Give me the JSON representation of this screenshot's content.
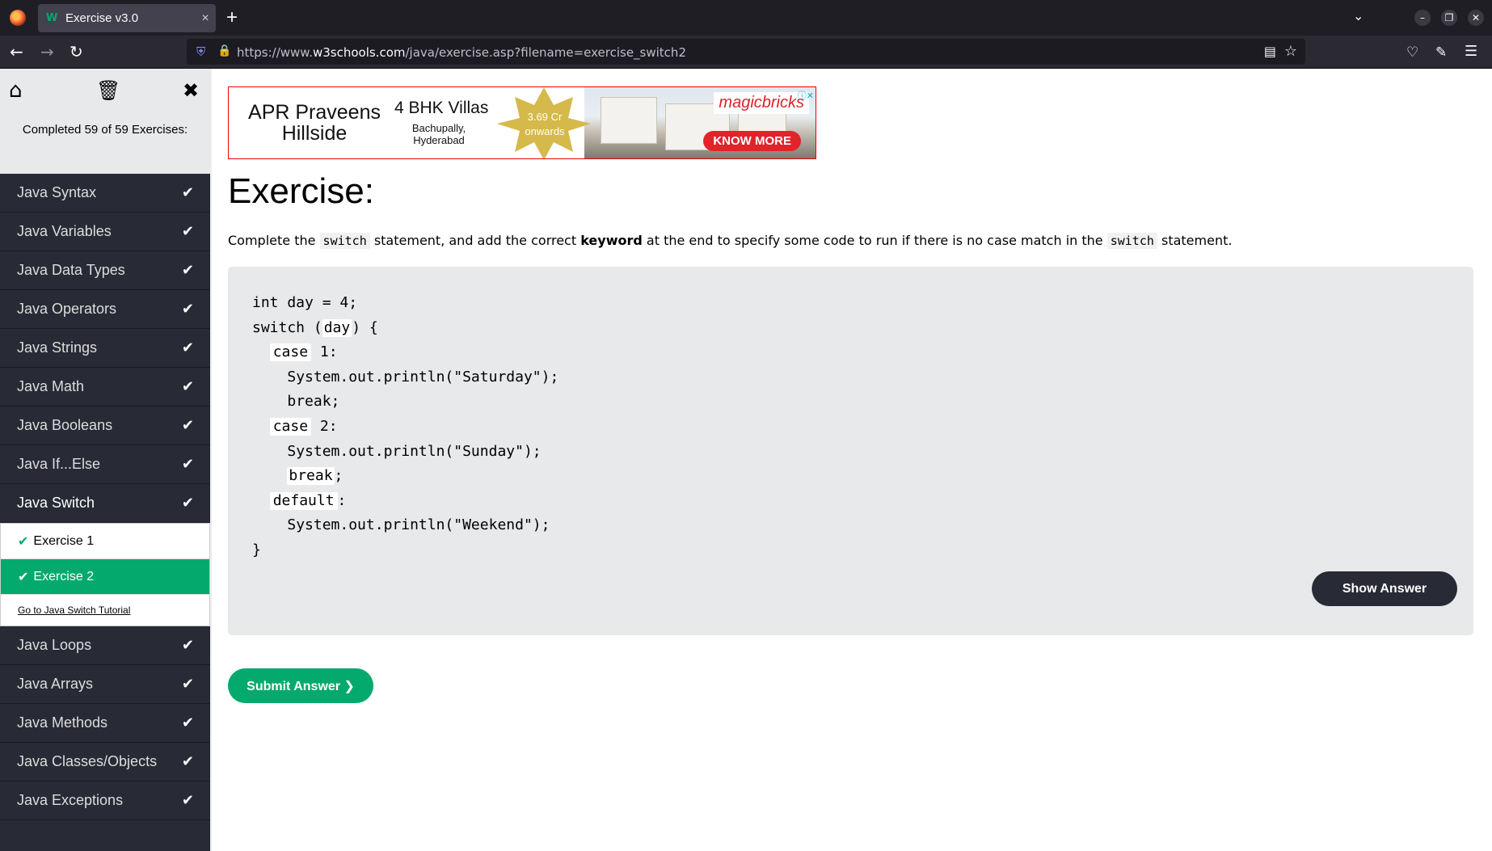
{
  "browser": {
    "tab_title": "Exercise v3.0",
    "tab_close": "×",
    "new_tab": "+",
    "url_prefix": "https://www.",
    "url_domain": "w3schools.com",
    "url_path": "/java/exercise.asp?filename=exercise_switch2"
  },
  "sidebar": {
    "progress": "Completed 59 of 59 Exercises:",
    "items": [
      {
        "label": "Java Syntax"
      },
      {
        "label": "Java Variables"
      },
      {
        "label": "Java Data Types"
      },
      {
        "label": "Java Operators"
      },
      {
        "label": "Java Strings"
      },
      {
        "label": "Java Math"
      },
      {
        "label": "Java Booleans"
      },
      {
        "label": "Java If...Else"
      },
      {
        "label": "Java Switch"
      },
      {
        "label": "Java Loops"
      },
      {
        "label": "Java Arrays"
      },
      {
        "label": "Java Methods"
      },
      {
        "label": "Java Classes/Objects"
      },
      {
        "label": "Java Exceptions"
      }
    ],
    "exercises": [
      {
        "label": "Exercise 1"
      },
      {
        "label": "Exercise 2"
      }
    ],
    "tutorial_link": "Go to Java Switch Tutorial"
  },
  "ad": {
    "title": "APR Praveens Hillside",
    "headline": "4 BHK Villas",
    "location": "Bachupally, Hyderabad",
    "price": "3.69 Cr onwards",
    "brand": "magicbricks",
    "cta": "KNOW MORE"
  },
  "exercise": {
    "heading": "Exercise:",
    "q_part1": "Complete the ",
    "q_code1": "switch",
    "q_part2": " statement, and add the correct ",
    "q_bold": "keyword",
    "q_part3": " at the end to specify some code to run if there is no case match in the ",
    "q_code2": "switch",
    "q_part4": " statement.",
    "code": {
      "line1": "int day = 4;",
      "line2_a": "switch (",
      "blank_day": "day",
      "line2_b": ") {",
      "blank_case1": "case",
      "line3_b": " 1:",
      "line4": "System.out.println(\"Saturday\");",
      "line5": "break;",
      "blank_case2": "case",
      "line6_b": " 2:",
      "line7": "System.out.println(\"Sunday\");",
      "blank_break": "break",
      "line8_b": ";",
      "blank_default": "default",
      "line9_b": ":",
      "line10": "System.out.println(\"Weekend\");",
      "line11": "}"
    },
    "show_answer": "Show Answer",
    "submit": "Submit Answer ❯"
  }
}
